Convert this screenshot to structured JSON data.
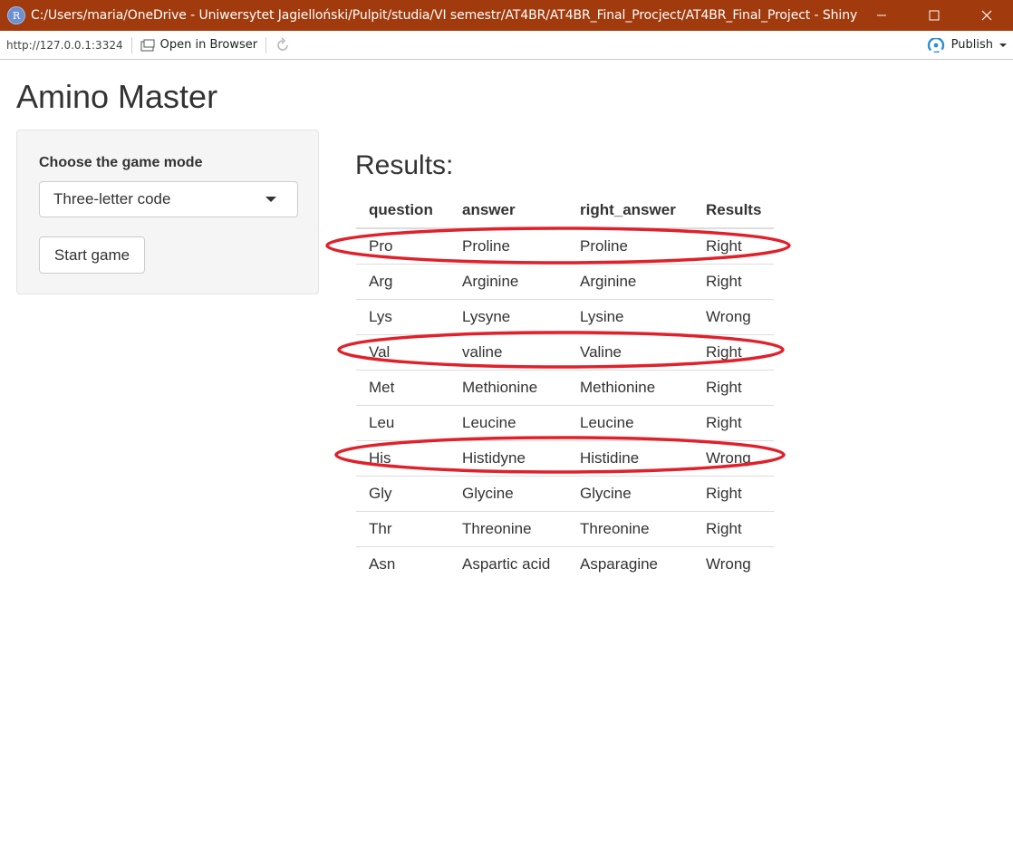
{
  "window": {
    "title": "C:/Users/maria/OneDrive - Uniwersytet Jagielloński/Pulpit/studia/VI semestr/AT4BR/AT4BR_Final_Procject/AT4BR_Final_Project - Shiny",
    "app_icon_letter": "R"
  },
  "toolbar": {
    "url": "http://127.0.0.1:3324",
    "open_in_browser": "Open in Browser",
    "publish": "Publish"
  },
  "app": {
    "title": "Amino Master",
    "sidebar": {
      "mode_label": "Choose the game mode",
      "mode_selected": "Three-letter code",
      "start_button": "Start game"
    },
    "results_heading": "Results:",
    "table": {
      "headers": [
        "question",
        "answer",
        "right_answer",
        "Results"
      ],
      "rows": [
        [
          "Pro",
          "Proline",
          "Proline",
          "Right"
        ],
        [
          "Arg",
          "Arginine",
          "Arginine",
          "Right"
        ],
        [
          "Lys",
          "Lysyne",
          "Lysine",
          "Wrong"
        ],
        [
          "Val",
          "valine",
          "Valine",
          "Right"
        ],
        [
          "Met",
          "Methionine",
          "Methionine",
          "Right"
        ],
        [
          "Leu",
          "Leucine",
          "Leucine",
          "Right"
        ],
        [
          "His",
          "Histidyne",
          "Histidine",
          "Wrong"
        ],
        [
          "Gly",
          "Glycine",
          "Glycine",
          "Right"
        ],
        [
          "Thr",
          "Threonine",
          "Threonine",
          "Right"
        ],
        [
          "Asn",
          "Aspartic acid",
          "Asparagine",
          "Wrong"
        ]
      ]
    }
  },
  "colors": {
    "titlebar": "#a13a0d",
    "annotation_ellipse": "#e0202a",
    "publish_icon": "#2f8fd0"
  }
}
